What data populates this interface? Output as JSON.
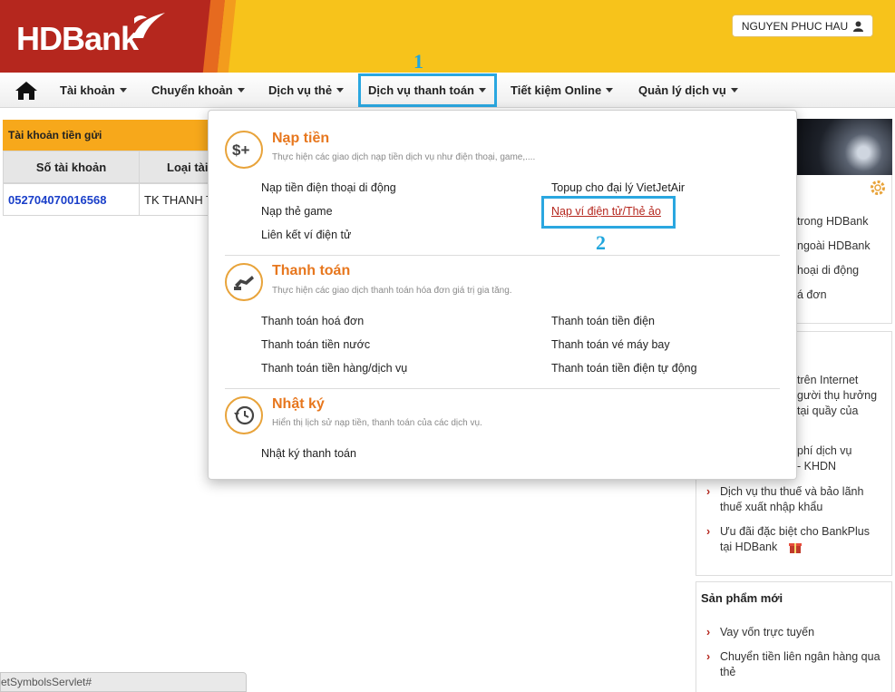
{
  "brand": {
    "logo_text": "HDBank"
  },
  "header": {
    "user_name": "NGUYEN PHUC HAU"
  },
  "nav": {
    "items": [
      {
        "label": "Tài khoản"
      },
      {
        "label": "Chuyển khoản"
      },
      {
        "label": "Dịch vụ thẻ"
      },
      {
        "label": "Dịch vụ thanh toán"
      },
      {
        "label": "Tiết kiệm Online"
      },
      {
        "label": "Quản lý dịch vụ"
      }
    ]
  },
  "annotations": {
    "step1": "1",
    "step2": "2"
  },
  "accounts": {
    "title": "Tài khoản tiền gửi",
    "columns": [
      "Số tài khoản",
      "Loại tài"
    ],
    "rows": [
      {
        "number": "052704070016568",
        "type": "TK THANH T"
      }
    ]
  },
  "dropdown": {
    "sections": [
      {
        "title": "Nạp tiền",
        "desc": "Thực hiện các giao dịch nạp tiền dịch vụ như điện thoại, game,....",
        "links": [
          "Nạp tiền điện thoại di động",
          "Topup cho đại lý VietJetAir",
          "Nạp thẻ game",
          "Nạp ví điện tử/Thẻ ảo",
          "Liên kết ví điện tử"
        ]
      },
      {
        "title": "Thanh toán",
        "desc": "Thực hiện các giao dịch thanh toán hóa đơn giá trị gia tăng.",
        "links": [
          "Thanh toán hoá đơn",
          "Thanh toán tiền điện",
          "Thanh toán tiền nước",
          "Thanh toán vé máy bay",
          "Thanh toán tiền hàng/dịch vụ",
          "Thanh toán tiền điện tự động"
        ]
      },
      {
        "title": "Nhật ký",
        "desc": "Hiển thị lịch sử nạp tiền, thanh toán của các dịch vụ.",
        "links": [
          "Nhật ký thanh toán"
        ]
      }
    ]
  },
  "sidebar": {
    "block1": [
      "trong HDBank",
      "ngoài HDBank",
      "hoại di động",
      "á đơn"
    ],
    "block2_lines": [
      "trên Internet",
      "gười thụ hưởng",
      "tại quầy của",
      "phí dịch vụ",
      "- KHDN"
    ],
    "links": [
      "Dịch vụ thu thuế và bảo lãnh thuế xuất nhập khẩu",
      "Ưu đãi đặc biệt cho BankPlus tại HDBank"
    ],
    "new_products_title": "Sản phẩm mới",
    "new_products": [
      "Vay vốn trực tuyến",
      "Chuyển tiền liên ngân hàng qua thẻ"
    ]
  },
  "statusbar": {
    "text": "etSymbolsServlet#"
  },
  "colors": {
    "brand_red": "#b5271e",
    "brand_yellow": "#f7c31b",
    "accent_orange": "#e7771e",
    "highlight_blue": "#2aa7e0"
  }
}
